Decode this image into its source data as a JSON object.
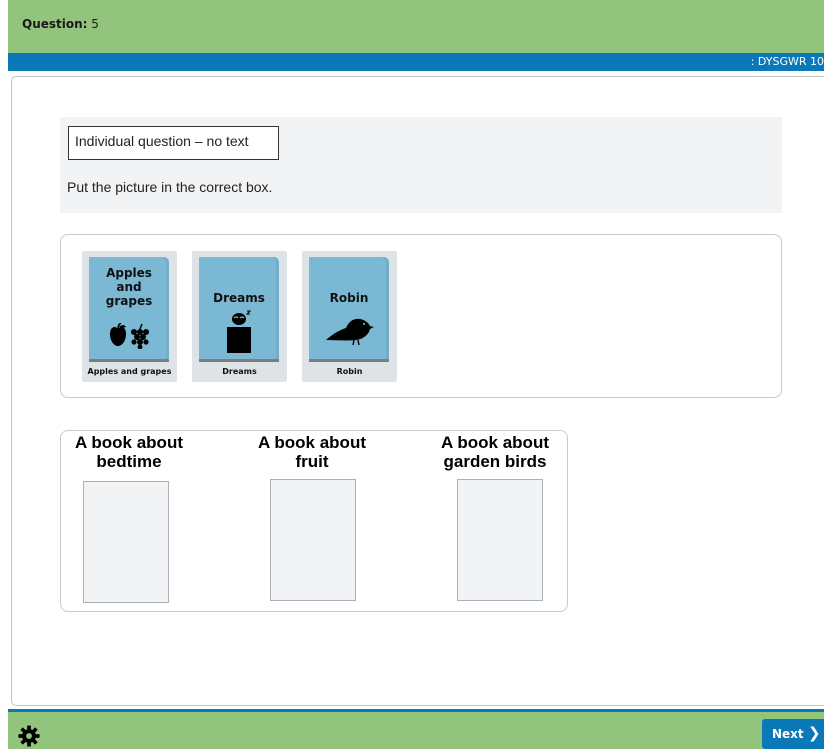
{
  "header": {
    "question_label": "Question:",
    "question_number": "5",
    "code": ": DYSGWR 10"
  },
  "instructions": {
    "box_label": "Individual question – no text",
    "text": "Put the picture in the correct box."
  },
  "source_items": [
    {
      "title_lines": [
        "Apples",
        "and",
        "grapes"
      ],
      "caption": "Apples and grapes",
      "icon": "apple-grapes-icon"
    },
    {
      "title_lines": [
        "Dreams"
      ],
      "caption": "Dreams",
      "icon": "sleeping-child-icon"
    },
    {
      "title_lines": [
        "Robin"
      ],
      "caption": "Robin",
      "icon": "bird-icon"
    }
  ],
  "targets": [
    {
      "heading_lines": [
        "A book about",
        "bedtime"
      ]
    },
    {
      "heading_lines": [
        "A book about",
        "fruit"
      ]
    },
    {
      "heading_lines": [
        "A book about",
        "garden birds"
      ]
    }
  ],
  "footer": {
    "settings_icon": "gear-icon",
    "next_label": "Next",
    "next_icon": "chevron-right-icon"
  },
  "colors": {
    "header_green": "#93c47d",
    "bar_blue": "#0b78b8",
    "book_blue": "#7bb8d4"
  }
}
